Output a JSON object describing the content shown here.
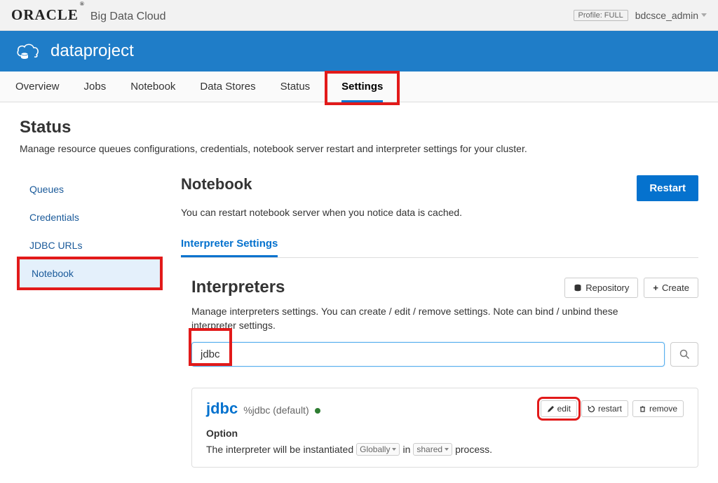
{
  "header": {
    "logo": "ORACLE",
    "product": "Big Data Cloud",
    "profile_badge": "Profile: FULL",
    "user": "bdcsce_admin"
  },
  "banner": {
    "project": "dataproject"
  },
  "nav": {
    "items": [
      "Overview",
      "Jobs",
      "Notebook",
      "Data Stores",
      "Status",
      "Settings"
    ],
    "active": "Settings"
  },
  "page": {
    "title": "Status",
    "description": "Manage resource queues configurations, credentials, notebook server restart and interpreter settings for your cluster."
  },
  "sidebar": {
    "items": [
      "Queues",
      "Credentials",
      "JDBC URLs",
      "Notebook"
    ],
    "active": "Notebook"
  },
  "notebook": {
    "title": "Notebook",
    "description": "You can restart notebook server when you notice data is cached.",
    "restart_button": "Restart",
    "subtab": "Interpreter Settings"
  },
  "interpreters": {
    "title": "Interpreters",
    "description": "Manage interpreters settings. You can create / edit / remove settings. Note can bind / unbind these interpreter settings.",
    "repository_btn": "Repository",
    "create_btn": "Create",
    "search_value": "jdbc"
  },
  "interpreter_entry": {
    "name": "jdbc",
    "alias": "%jdbc (default)",
    "edit": "edit",
    "restart": "restart",
    "remove": "remove",
    "option_label": "Option",
    "option_prefix": "The interpreter will be instantiated",
    "scope_select": "Globally",
    "option_in": "in",
    "mode_select": "shared",
    "option_suffix": "process."
  }
}
